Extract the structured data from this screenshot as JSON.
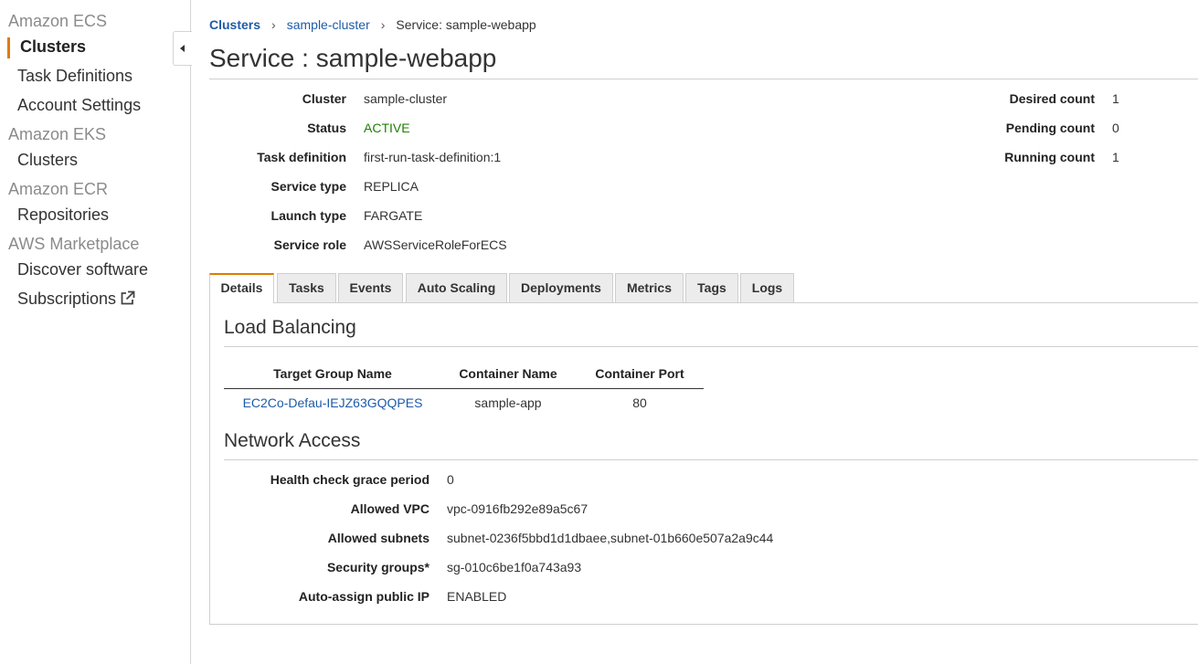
{
  "sidebar": {
    "sections": [
      {
        "title": "Amazon ECS",
        "items": [
          "Clusters",
          "Task Definitions",
          "Account Settings"
        ]
      },
      {
        "title": "Amazon EKS",
        "items": [
          "Clusters"
        ]
      },
      {
        "title": "Amazon ECR",
        "items": [
          "Repositories"
        ]
      },
      {
        "title": "AWS Marketplace",
        "items": [
          "Discover software",
          "Subscriptions"
        ]
      }
    ],
    "active_item": "Clusters",
    "external_link_icon": "external-link-icon",
    "collapse_icon": "chevron-left-icon"
  },
  "breadcrumb": [
    "Clusters",
    "sample-cluster",
    "Service: sample-webapp"
  ],
  "page_title": "Service : sample-webapp",
  "summary": {
    "left": [
      {
        "label": "Cluster",
        "value": "sample-cluster",
        "link": true
      },
      {
        "label": "Status",
        "value": "ACTIVE",
        "status": "active"
      },
      {
        "label": "Task definition",
        "value": "first-run-task-definition:1",
        "link": true
      },
      {
        "label": "Service type",
        "value": "REPLICA"
      },
      {
        "label": "Launch type",
        "value": "FARGATE"
      },
      {
        "label": "Service role",
        "value": "AWSServiceRoleForECS"
      }
    ],
    "right": [
      {
        "label": "Desired count",
        "value": "1"
      },
      {
        "label": "Pending count",
        "value": "0"
      },
      {
        "label": "Running count",
        "value": "1"
      }
    ]
  },
  "tabs": [
    "Details",
    "Tasks",
    "Events",
    "Auto Scaling",
    "Deployments",
    "Metrics",
    "Tags",
    "Logs"
  ],
  "active_tab": "Details",
  "load_balancing": {
    "heading": "Load Balancing",
    "columns": [
      "Target Group Name",
      "Container Name",
      "Container Port"
    ],
    "rows": [
      [
        "EC2Co-Defau-IEJZ63GQQPES",
        "sample-app",
        "80"
      ]
    ]
  },
  "network_access": {
    "heading": "Network Access",
    "fields": [
      {
        "label": "Health check grace period",
        "value": "0"
      },
      {
        "label": "Allowed VPC",
        "value": "vpc-0916fb292e89a5c67",
        "link": true
      },
      {
        "label": "Allowed subnets",
        "value": "subnet-0236f5bbd1d1dbaee,subnet-01b660e507a2a9c44",
        "link": true
      },
      {
        "label": "Security groups*",
        "value": "sg-010c6be1f0a743a93",
        "link": true
      },
      {
        "label": "Auto-assign public IP",
        "value": "ENABLED"
      }
    ]
  },
  "colors": {
    "link": "#1e5ba8",
    "active_status": "#1d8102",
    "accent": "#e07b00"
  }
}
